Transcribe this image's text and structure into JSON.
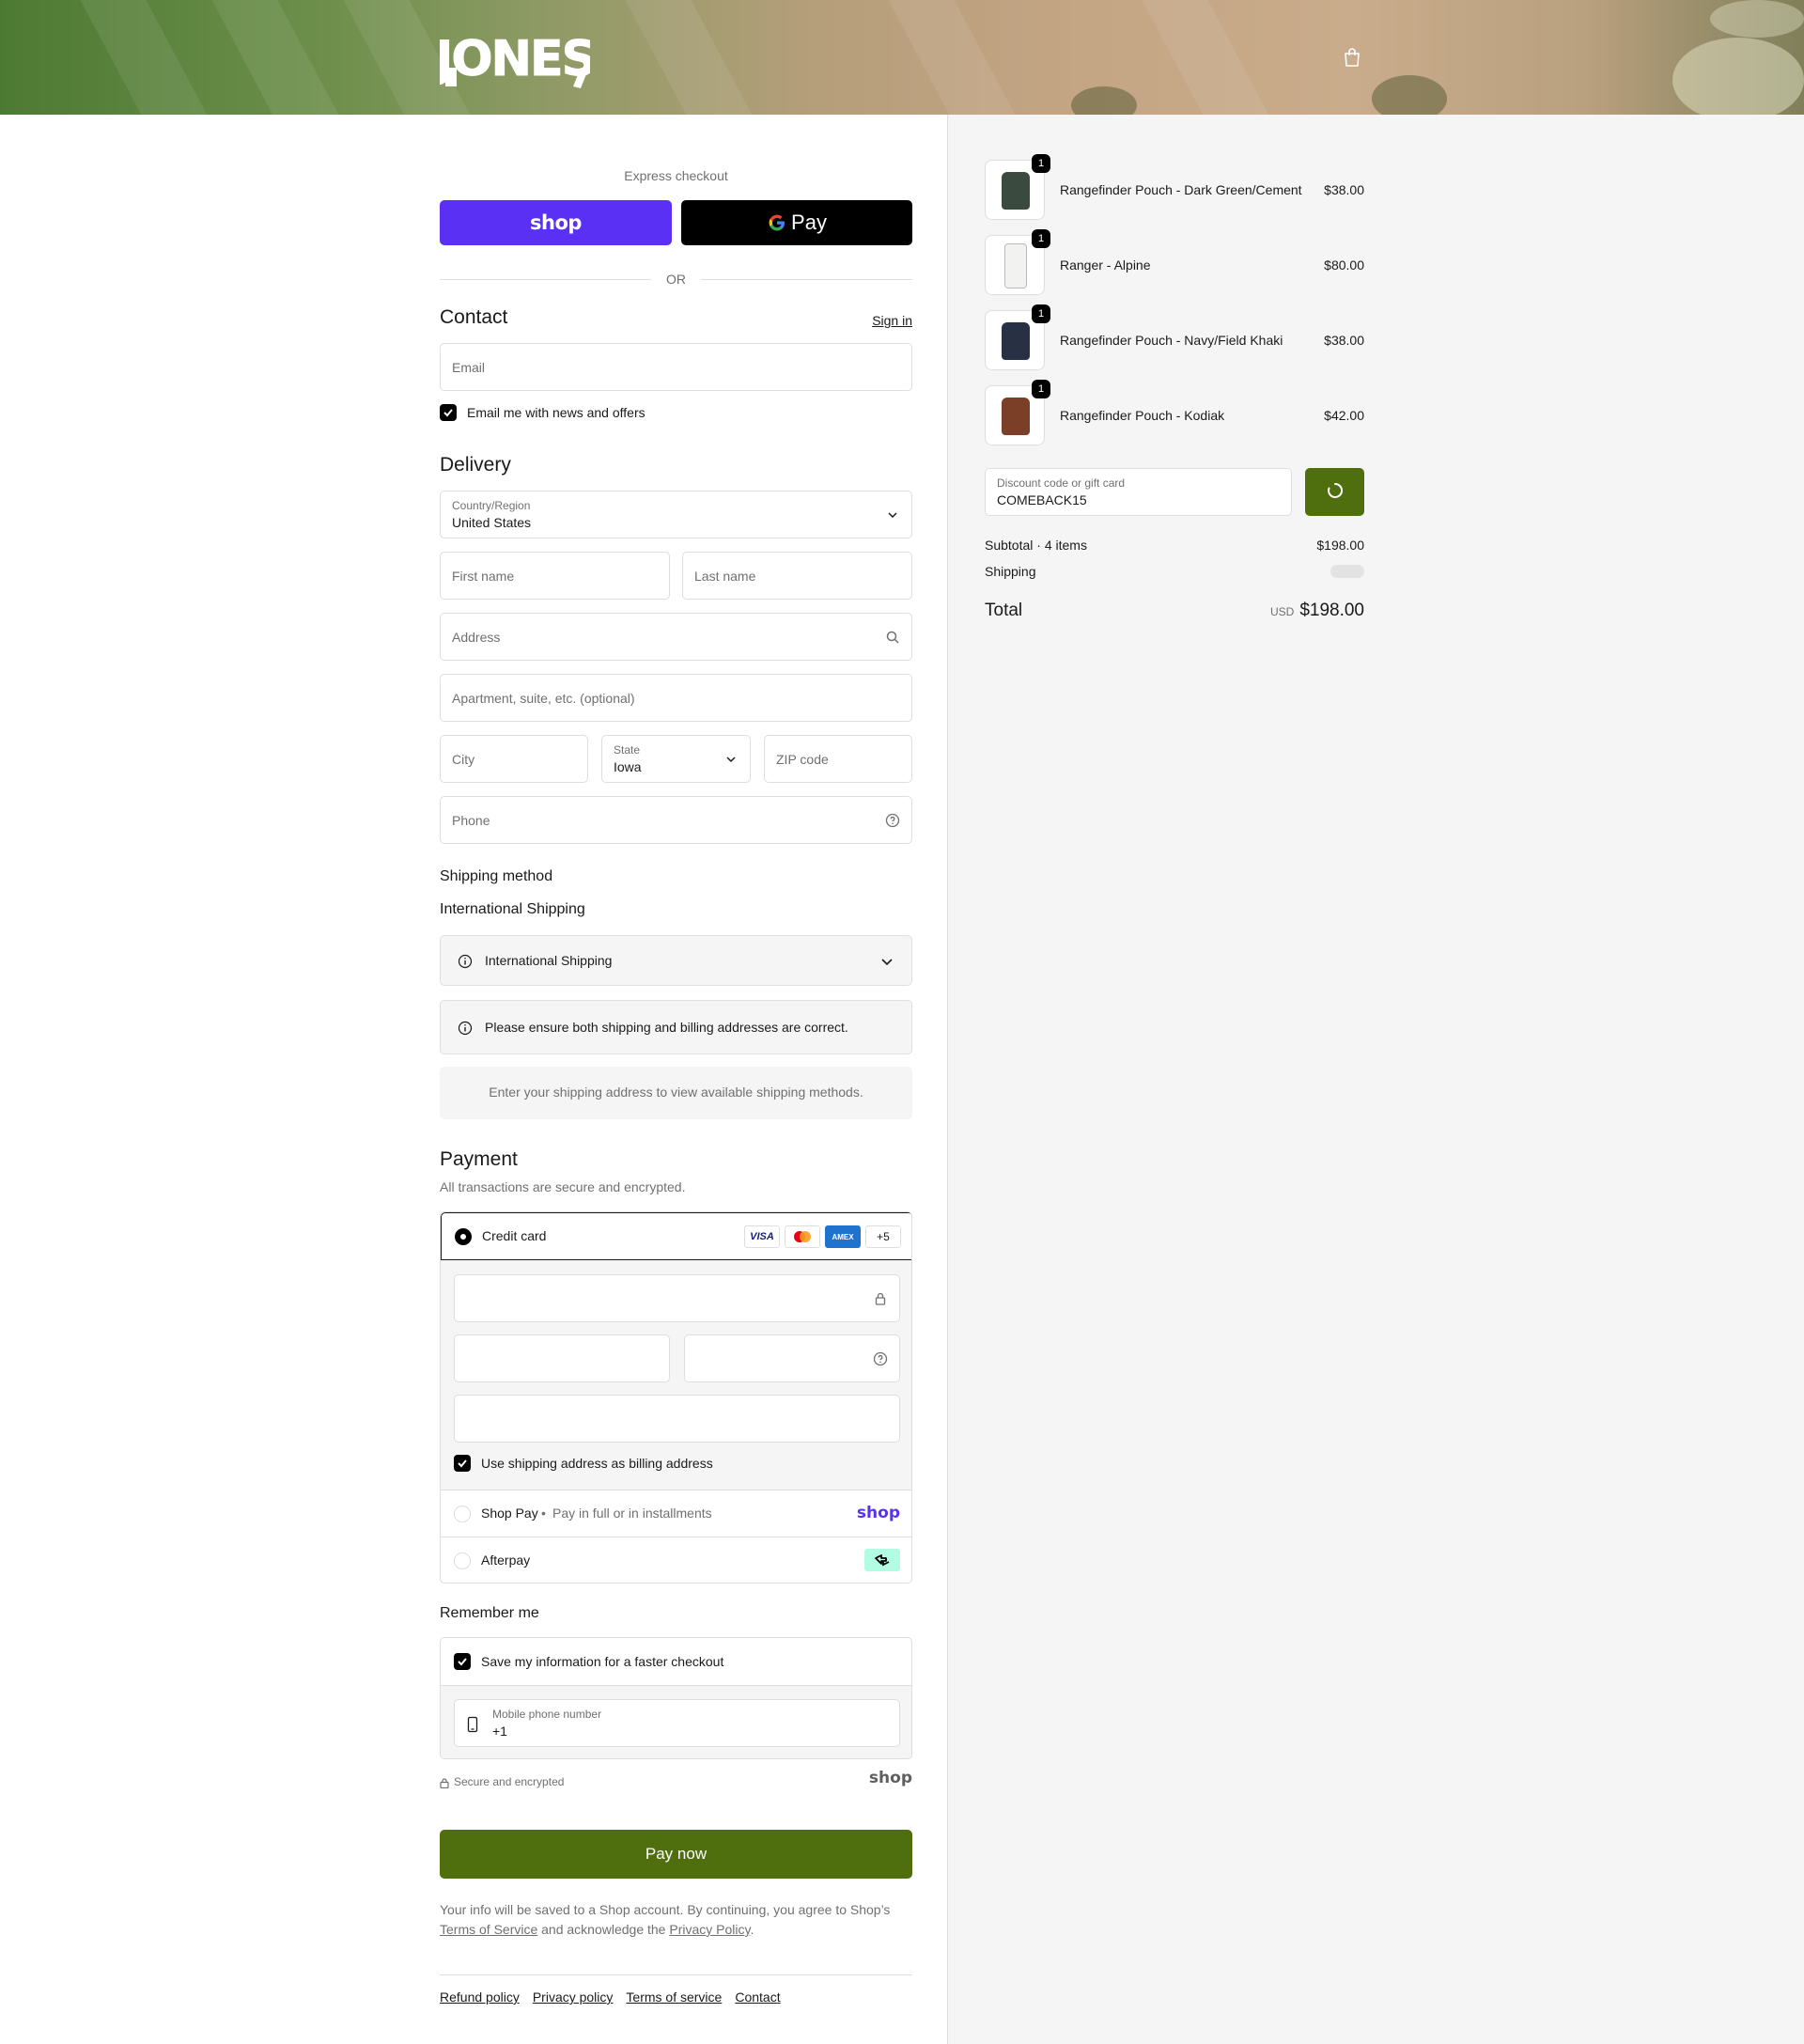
{
  "brand": {
    "logo_text": "JONES"
  },
  "express": {
    "title": "Express checkout",
    "shop_pay_label": "shop",
    "gpay_label": "Pay",
    "or_label": "OR"
  },
  "contact": {
    "heading": "Contact",
    "sign_in": "Sign in",
    "email_placeholder": "Email",
    "newsletter_label": "Email me with news and offers",
    "newsletter_checked": true
  },
  "delivery": {
    "heading": "Delivery",
    "country_label": "Country/Region",
    "country_value": "United States",
    "first_name_placeholder": "First name",
    "last_name_placeholder": "Last name",
    "address_placeholder": "Address",
    "apartment_placeholder": "Apartment, suite, etc. (optional)",
    "city_placeholder": "City",
    "state_label": "State",
    "state_value": "Iowa",
    "zip_placeholder": "ZIP code",
    "phone_placeholder": "Phone"
  },
  "shipping": {
    "heading": "Shipping method",
    "subheading": "International Shipping",
    "dropdown_label": "International Shipping",
    "notice": "Please ensure both shipping and billing addresses are correct.",
    "empty_message": "Enter your shipping address to view available shipping methods."
  },
  "payment": {
    "heading": "Payment",
    "subtitle": "All transactions are secure and encrypted.",
    "credit_card_label": "Credit card",
    "card_brands": [
      "VISA",
      "Mastercard",
      "AMEX"
    ],
    "more_brands": "+5",
    "billing_same_label": "Use shipping address as billing address",
    "billing_same_checked": true,
    "shop_pay_label": "Shop Pay",
    "shop_pay_desc": "Pay in full or in installments",
    "shop_pay_logo": "shop",
    "afterpay_label": "Afterpay"
  },
  "remember": {
    "heading": "Remember me",
    "save_label": "Save my information for a faster checkout",
    "save_checked": true,
    "phone_label": "Mobile phone number",
    "phone_value": "+1",
    "secure_label": "Secure and encrypted",
    "shop_logo": "shop"
  },
  "pay_now": "Pay now",
  "legal": {
    "line1": "Your info will be saved to a Shop account. By continuing, you agree to Shop’s",
    "terms": "Terms of Service",
    "middle": "and acknowledge the",
    "privacy": "Privacy Policy",
    "end": "."
  },
  "footer": {
    "links": [
      "Refund policy",
      "Privacy policy",
      "Terms of service",
      "Contact"
    ]
  },
  "cart": {
    "items": [
      {
        "name": "Rangefinder Pouch - Dark Green/Cement",
        "price": "$38.00",
        "qty": "1",
        "color": "#3a4a3e"
      },
      {
        "name": "Ranger - Alpine",
        "price": "$80.00",
        "qty": "1",
        "color": "#f2f2f0"
      },
      {
        "name": "Rangefinder Pouch - Navy/Field Khaki",
        "price": "$38.00",
        "qty": "1",
        "color": "#283043"
      },
      {
        "name": "Rangefinder Pouch - Kodiak",
        "price": "$42.00",
        "qty": "1",
        "color": "#7a3f26"
      }
    ],
    "discount_label": "Discount code or gift card",
    "discount_value": "COMEBACK15",
    "subtotal_label": "Subtotal · 4 items",
    "subtotal_value": "$198.00",
    "shipping_label": "Shipping",
    "total_label": "Total",
    "currency": "USD",
    "total_value": "$198.00"
  },
  "colors": {
    "accent": "#4f6f0f",
    "shop_purple": "#5a31f4",
    "afterpay": "#b2fce4"
  }
}
